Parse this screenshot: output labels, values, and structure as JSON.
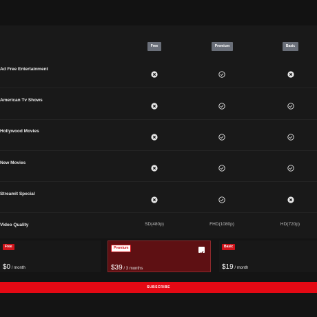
{
  "columns": [
    {
      "label": "Free"
    },
    {
      "label": "Premium"
    },
    {
      "label": "Basic"
    }
  ],
  "rows": [
    {
      "label": "Ad Free Entertainment",
      "values": [
        "x",
        "check",
        "x"
      ]
    },
    {
      "label": "American Tv Shows",
      "values": [
        "x",
        "check",
        "check"
      ]
    },
    {
      "label": "Hollywood Movies",
      "values": [
        "x",
        "check",
        "check"
      ]
    },
    {
      "label": "New Movies",
      "values": [
        "x",
        "check",
        "check"
      ]
    },
    {
      "label": "Streamit Special",
      "values": [
        "x",
        "check",
        "x"
      ]
    }
  ],
  "video_quality": {
    "label": "Video Quality",
    "values": [
      "SD(480p)",
      "FHD(1080p)",
      "HD(720p)"
    ]
  },
  "plans": [
    {
      "badge": "Free",
      "price": "$0",
      "period": " / month",
      "selected": false
    },
    {
      "badge": "Premium",
      "price": "$39",
      "period": " / 3 months",
      "selected": true
    },
    {
      "badge": "Basic",
      "price": "$19",
      "period": " / month",
      "selected": false
    }
  ],
  "subscribe_label": "SUBSCRIBE",
  "colors": {
    "accent": "#e50914",
    "selected_plan_bg": "#5e1013",
    "header_badge": "#6a6f79"
  },
  "icons": {
    "x": "x-circle-icon",
    "check": "check-circle-icon"
  }
}
